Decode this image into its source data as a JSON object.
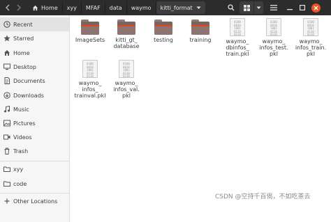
{
  "header": {
    "breadcrumbs": [
      "Home",
      "xyy",
      "MFAF",
      "data",
      "waymo"
    ],
    "current": "kitti_format"
  },
  "sidebar": {
    "items": [
      {
        "label": "Recent",
        "icon": "clock-icon",
        "active": true
      },
      {
        "label": "Starred",
        "icon": "star-icon"
      },
      {
        "label": "Home",
        "icon": "home-icon"
      },
      {
        "label": "Desktop",
        "icon": "desktop-icon"
      },
      {
        "label": "Documents",
        "icon": "document-icon"
      },
      {
        "label": "Downloads",
        "icon": "download-icon"
      },
      {
        "label": "Music",
        "icon": "music-icon"
      },
      {
        "label": "Pictures",
        "icon": "picture-icon"
      },
      {
        "label": "Videos",
        "icon": "video-icon"
      },
      {
        "label": "Trash",
        "icon": "trash-icon"
      }
    ],
    "bookmarks": [
      {
        "label": "xyy",
        "icon": "folder-icon"
      },
      {
        "label": "code",
        "icon": "folder-icon"
      }
    ],
    "other": {
      "label": "Other Locations",
      "icon": "plus-icon"
    }
  },
  "files": [
    {
      "name": "ImageSets",
      "type": "folder"
    },
    {
      "name": "kitti_gt_\ndatabase",
      "type": "folder"
    },
    {
      "name": "testing",
      "type": "folder"
    },
    {
      "name": "training",
      "type": "folder"
    },
    {
      "name": "waymo_\ndbinfos_\ntrain.pkl",
      "type": "binary"
    },
    {
      "name": "waymo_\ninfos_test.\npkl",
      "type": "binary"
    },
    {
      "name": "waymo_\ninfos_train.\npkl",
      "type": "binary"
    },
    {
      "name": "waymo_\ninfos_\ntrainval.pkl",
      "type": "binary"
    },
    {
      "name": "waymo_\ninfos_val.\npkl",
      "type": "binary"
    }
  ],
  "binary_glyph": "0100\n0010\n1001\n0110\n0110",
  "watermark": "CSDN @空持千百偈，不如吃茶去",
  "colors": {
    "header": "#2c2c2c",
    "folder_accent": "#df4a1c",
    "close": "#e95420"
  }
}
